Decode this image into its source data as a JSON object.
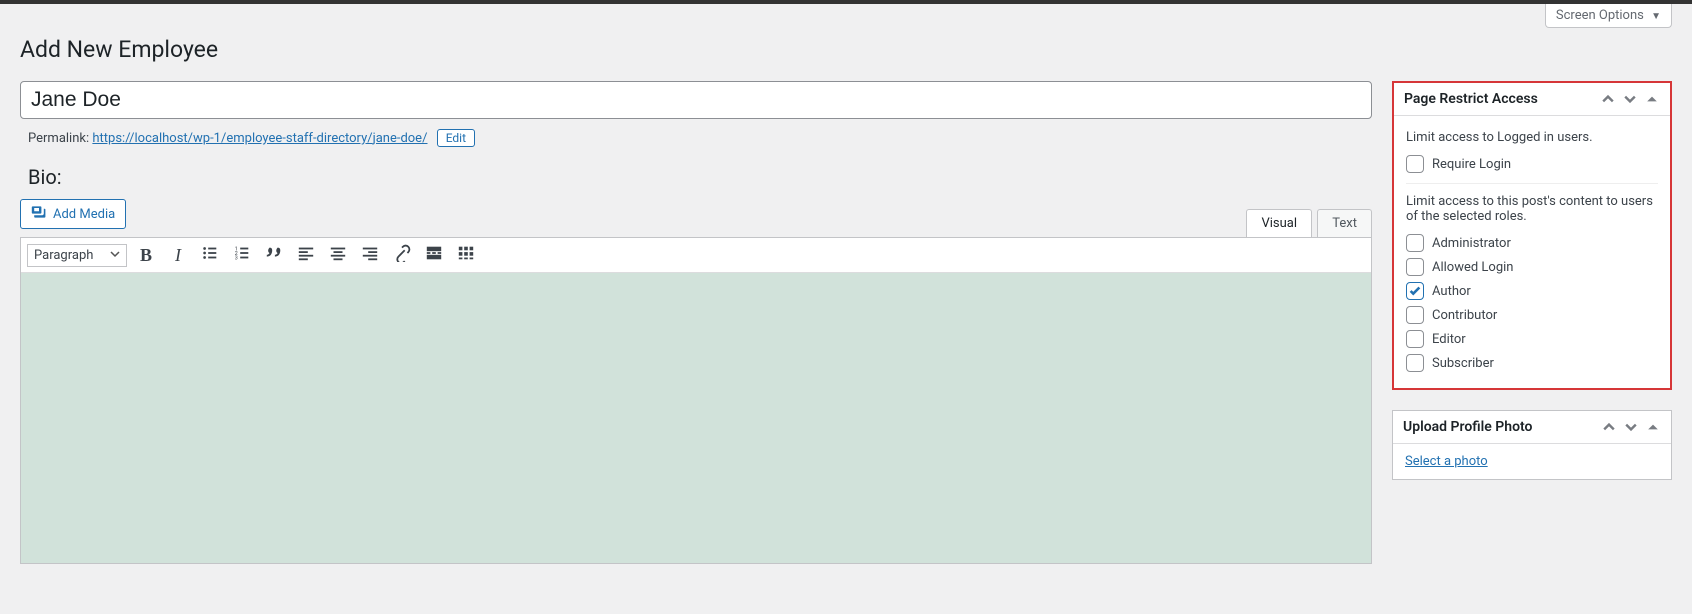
{
  "screen_options": {
    "label": "Screen Options"
  },
  "page_title": "Add New Employee",
  "title_input": {
    "value": "Jane Doe"
  },
  "permalink": {
    "label": "Permalink:",
    "base_url": "https://localhost/wp-1/employee-staff-directory/",
    "slug": "jane-doe/",
    "edit_label": "Edit"
  },
  "bio": {
    "label": "Bio:"
  },
  "add_media": {
    "label": "Add Media"
  },
  "editor_tabs": {
    "visual": "Visual",
    "text": "Text"
  },
  "toolbar": {
    "format_label": "Paragraph"
  },
  "sidebar": {
    "restrict": {
      "title": "Page Restrict Access",
      "desc1": "Limit access to Logged in users.",
      "require_login": "Require Login",
      "desc2": "Limit access to this post's content to users of the selected roles.",
      "roles": [
        {
          "label": "Administrator",
          "checked": false
        },
        {
          "label": "Allowed Login",
          "checked": false
        },
        {
          "label": "Author",
          "checked": true
        },
        {
          "label": "Contributor",
          "checked": false
        },
        {
          "label": "Editor",
          "checked": false
        },
        {
          "label": "Subscriber",
          "checked": false
        }
      ]
    },
    "photo": {
      "title": "Upload Profile Photo",
      "link": "Select a photo"
    }
  }
}
